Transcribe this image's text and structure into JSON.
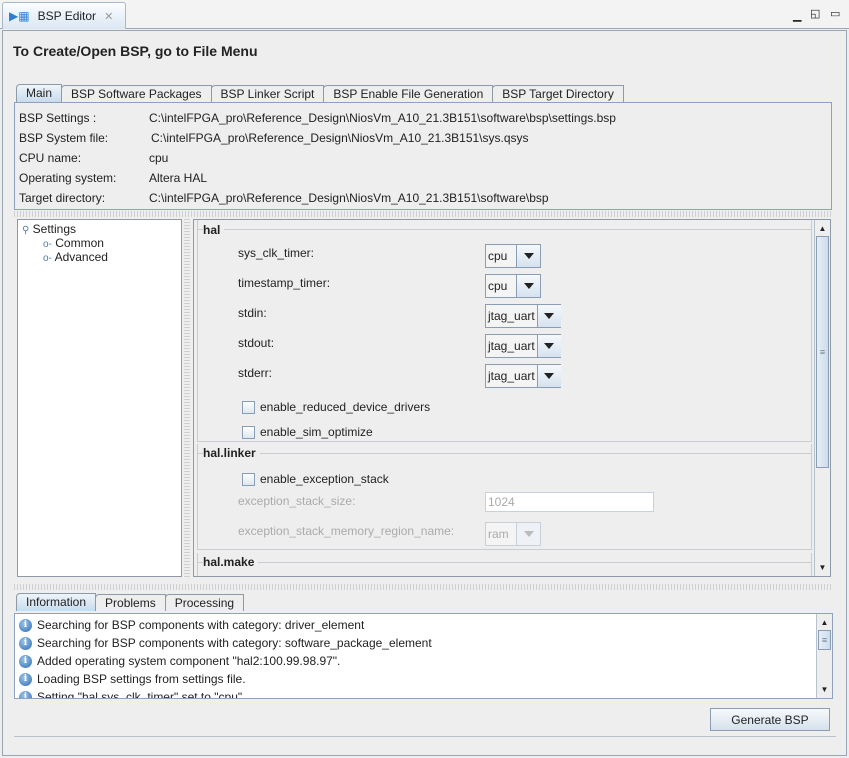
{
  "editor_tab": {
    "title": "BSP Editor"
  },
  "heading": "To Create/Open BSP, go to File Menu",
  "main_tabs": [
    "Main",
    "BSP Software Packages",
    "BSP Linker Script",
    "BSP Enable File Generation",
    "BSP Target Directory"
  ],
  "info": [
    {
      "label": "BSP Settings :",
      "value": "C:\\intelFPGA_pro\\Reference_Design\\NiosVm_A10_21.3B151\\software\\bsp\\settings.bsp"
    },
    {
      "label": "BSP System file:",
      "value": "C:\\intelFPGA_pro\\Reference_Design\\NiosVm_A10_21.3B151\\sys.qsys"
    },
    {
      "label": "CPU name:",
      "value": "cpu"
    },
    {
      "label": "Operating system:",
      "value": "Altera HAL"
    },
    {
      "label": "Target directory:",
      "value": "C:\\intelFPGA_pro\\Reference_Design\\NiosVm_A10_21.3B151\\software\\bsp"
    }
  ],
  "tree": {
    "root": "Settings",
    "children": [
      "Common",
      "Advanced"
    ]
  },
  "hal": {
    "title": "hal",
    "combos": [
      {
        "label": "sys_clk_timer:",
        "value": "cpu"
      },
      {
        "label": "timestamp_timer:",
        "value": "cpu"
      },
      {
        "label": "stdin:",
        "value": "jtag_uart"
      },
      {
        "label": "stdout:",
        "value": "jtag_uart"
      },
      {
        "label": "stderr:",
        "value": "jtag_uart"
      }
    ],
    "checkboxes": [
      {
        "label": "enable_reduced_device_drivers",
        "checked": false
      },
      {
        "label": "enable_sim_optimize",
        "checked": false
      }
    ]
  },
  "hal_linker": {
    "title": "hal.linker",
    "checkbox": {
      "label": "enable_exception_stack",
      "checked": false
    },
    "stack_size_label": "exception_stack_size:",
    "stack_size_value": "1024",
    "region_label": "exception_stack_memory_region_name:",
    "region_value": "ram"
  },
  "hal_make": {
    "title": "hal.make"
  },
  "log_tabs": [
    "Information",
    "Problems",
    "Processing"
  ],
  "log": [
    "Searching for BSP components with category: driver_element",
    "Searching for BSP components with category: software_package_element",
    "Added operating system component \"hal2:100.99.98.97\".",
    "Loading BSP settings from settings file.",
    "Setting \"hal.sys_clk_timer\" set to \"cpu\"."
  ],
  "generate_label": "Generate BSP"
}
